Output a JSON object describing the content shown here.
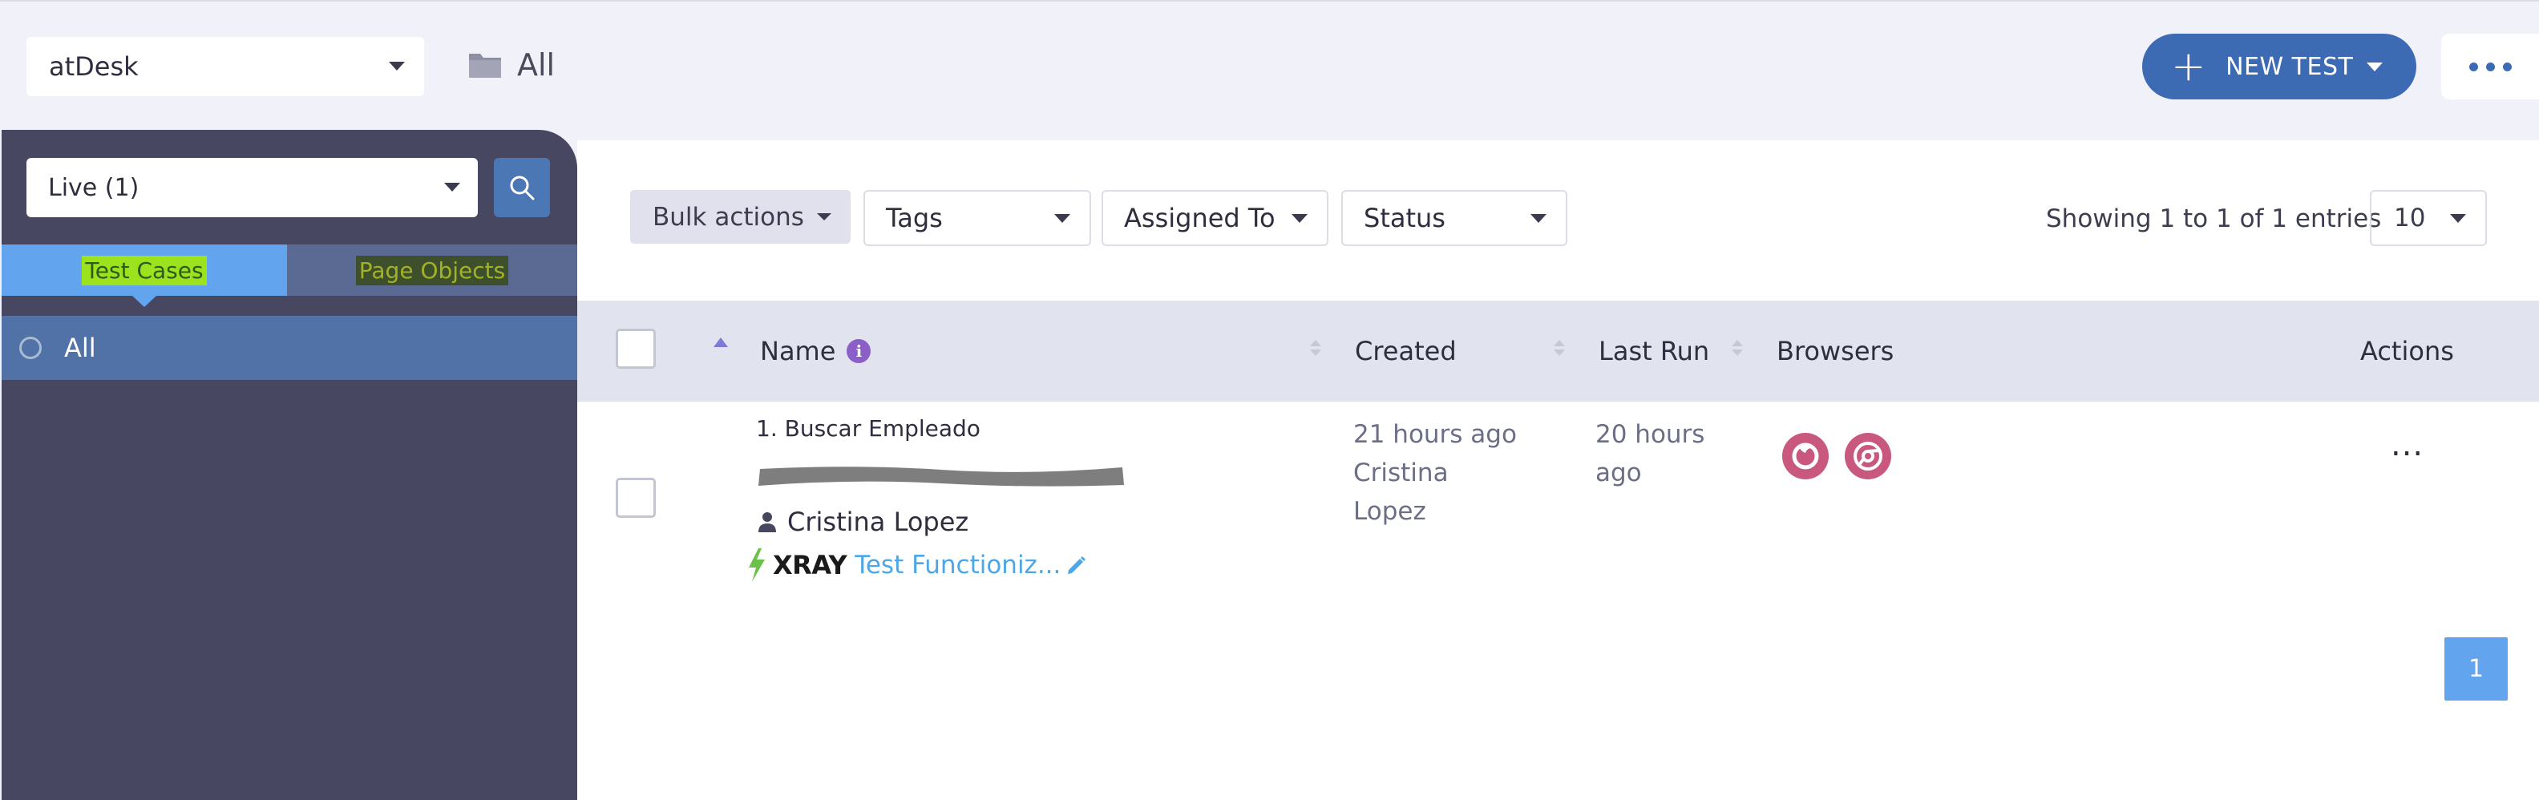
{
  "header": {
    "project": "atDesk",
    "breadcrumb": "All",
    "new_test_label": "NEW TEST"
  },
  "sidebar": {
    "filter": "Live (1)",
    "tabs": [
      {
        "label": "Test Cases",
        "active": true
      },
      {
        "label": "Page Objects",
        "active": false
      }
    ],
    "tree": [
      {
        "label": "All",
        "selected": true
      }
    ]
  },
  "toolbar": {
    "bulk_actions": "Bulk actions",
    "filters": [
      "Tags",
      "Assigned To",
      "Status"
    ],
    "entries_text": "Showing 1 to 1 of 1 entries",
    "page_size": "10"
  },
  "table": {
    "columns": [
      "Name",
      "Created",
      "Last Run",
      "Browsers",
      "Actions"
    ],
    "rows": [
      {
        "name": "1. Buscar Empleado",
        "owner": "Cristina Lopez",
        "created_line1": "21 hours ago",
        "created_line2": "Cristina",
        "created_line3": "Lopez",
        "last_run_line1": "20 hours",
        "last_run_line2": "ago",
        "integration": "XRAY",
        "integration_link": "Test Functioniz...",
        "browsers": [
          "firefox-icon",
          "chrome-icon"
        ],
        "actions": "..."
      }
    ]
  },
  "pagination": {
    "current_page": "1"
  },
  "colors": {
    "accent": "#3d6bb3",
    "sidebar_bg": "#484762",
    "tab_active": "#63a4ef",
    "tree_selected": "#5072a6",
    "browser_icon": "#c8587d"
  }
}
